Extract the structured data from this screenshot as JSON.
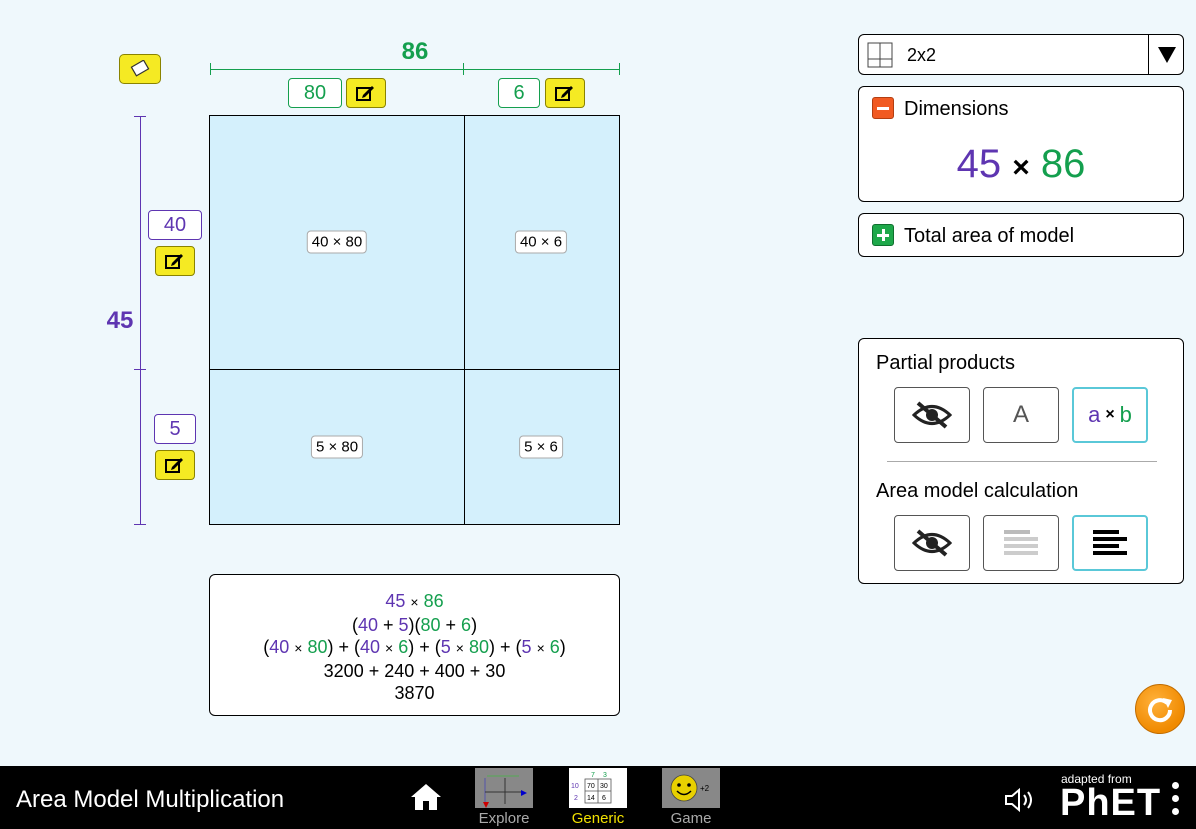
{
  "total_width": "86",
  "total_height": "45",
  "width_terms": [
    "80",
    "6"
  ],
  "height_terms": [
    "40",
    "5"
  ],
  "cells": {
    "r0c0": "40 × 80",
    "r0c1": "40 × 6",
    "r1c0": "5 × 80",
    "r1c1": "5 × 6"
  },
  "calculation": {
    "line5": "3200 + 240 + 400 + 30",
    "line6": "3870"
  },
  "layout_selector": {
    "value": "2x2"
  },
  "dimensions_panel": {
    "title": "Dimensions",
    "times": "×"
  },
  "total_area_panel": {
    "title": "Total area of model"
  },
  "partial_products": {
    "title": "Partial products",
    "option_a": "A",
    "option_ab_a": "a",
    "option_ab_b": "b",
    "times": "×"
  },
  "area_model_calculation": {
    "title": "Area model calculation"
  },
  "navbar": {
    "title": "Area Model Multiplication",
    "screens": [
      "Explore",
      "Generic",
      "Game"
    ],
    "active_screen": "Generic",
    "brand_small": "adapted from",
    "brand": "PhET"
  },
  "colors": {
    "width": "#149f4e",
    "height": "#5e35b1",
    "cell": "#d4f0fc",
    "highlight": "#5ac8d8"
  }
}
